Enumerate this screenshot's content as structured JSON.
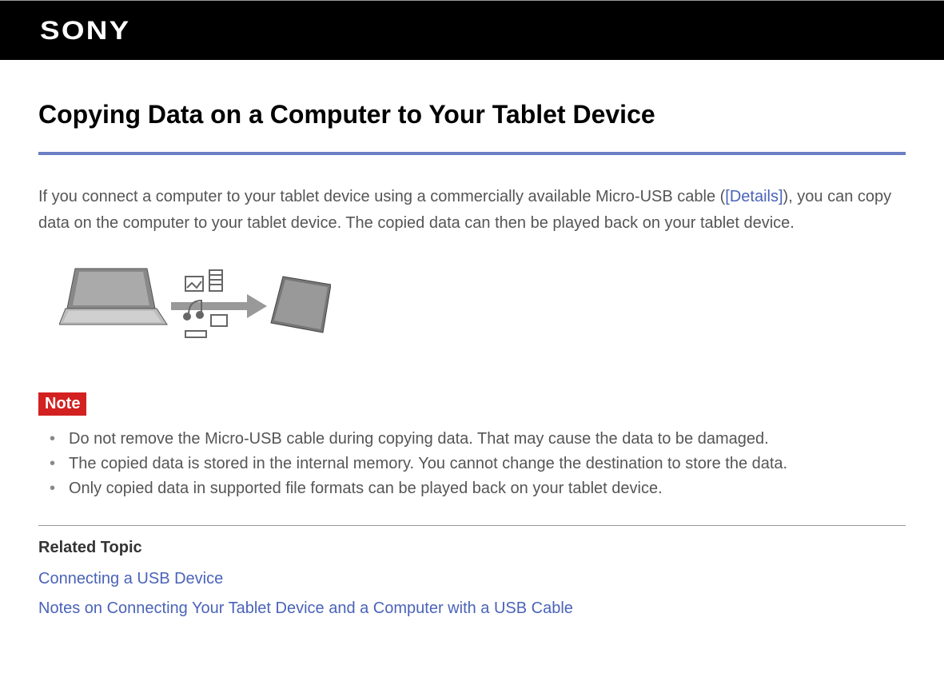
{
  "header": {
    "brand": "SONY"
  },
  "page": {
    "title": "Copying Data on a Computer to Your Tablet Device",
    "intro_before_link": "If you connect a computer to your tablet device using a commercially available Micro-USB cable (",
    "details_link": "[Details]",
    "intro_after_link": "), you can copy data on the computer to your tablet device. The copied data can then be played back on your tablet device."
  },
  "note": {
    "label": "Note",
    "items": [
      "Do not remove the Micro-USB cable during copying data. That may cause the data to be damaged.",
      "The copied data is stored in the internal memory. You cannot change the destination to store the data.",
      "Only copied data in supported file formats can be played back on your tablet device."
    ]
  },
  "related": {
    "heading": "Related Topic",
    "links": [
      "Connecting a USB Device",
      "Notes on Connecting Your Tablet Device and a Computer with a USB Cable"
    ]
  }
}
